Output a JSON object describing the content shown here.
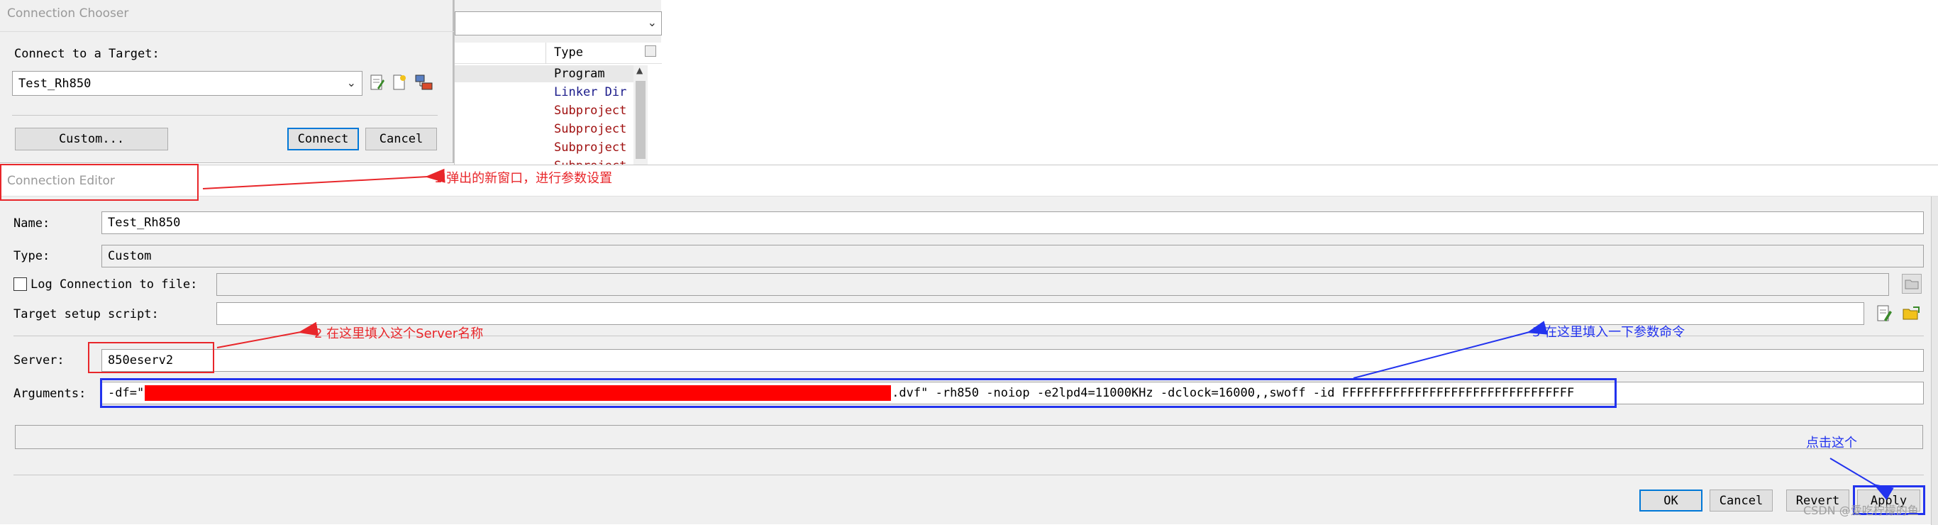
{
  "connection_chooser": {
    "title": "Connection Chooser",
    "connect_label": "Connect to a Target:",
    "target_value": "Test_Rh850",
    "custom_button": "Custom...",
    "connect_button": "Connect",
    "cancel_button": "Cancel"
  },
  "background_table": {
    "type_header": "Type",
    "rows": [
      "Program",
      "Linker Dir",
      "Subproject",
      "Subproject",
      "Subproject",
      "Subproject"
    ]
  },
  "connection_editor": {
    "title": "Connection Editor",
    "name_label": "Name:",
    "name_value": "Test_Rh850",
    "type_label": "Type:",
    "type_value": "Custom",
    "log_label": "Log Connection to file:",
    "log_checked": false,
    "setup_label": "Target setup script:",
    "server_label": "Server:",
    "server_value": "850eserv2",
    "arguments_label": "Arguments:",
    "arguments_prefix": "-df=\"",
    "arguments_suffix": ".dvf\" -rh850 -noiop -e2lpd4=11000KHz -dclock=16000,,swoff -id FFFFFFFFFFFFFFFFFFFFFFFFFFFFFFFF",
    "ok_button": "OK",
    "cancel_button": "Cancel",
    "revert_button": "Revert",
    "apply_button": "Apply"
  },
  "annotations": {
    "step1": "1.弹出的新窗口，进行参数设置",
    "step2": "2 在这里填入这个Server名称",
    "step3": "3 在这里填入一下参数命令",
    "click_this": "点击这个"
  },
  "watermark": "CSDN @爱吃柠檬的鱼",
  "colors": {
    "annotation_red": "#e8262a",
    "annotation_blue": "#2233ee",
    "redaction": "#ff0000",
    "dialog_bg": "#f0f0f0",
    "default_button_border": "#0078d7"
  }
}
